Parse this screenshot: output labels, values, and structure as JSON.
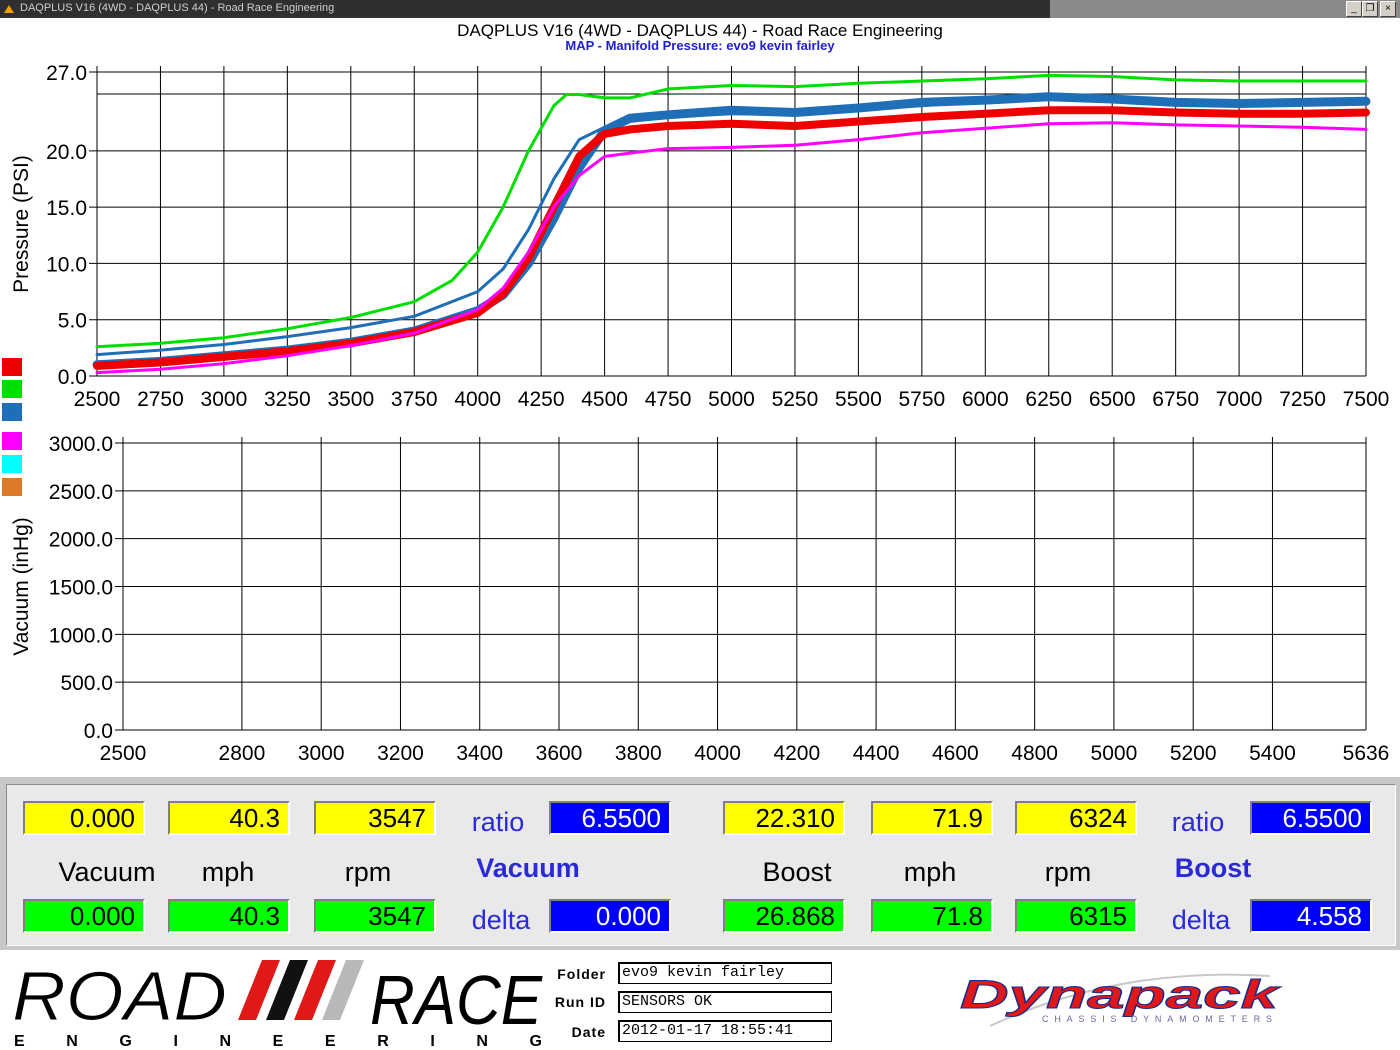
{
  "window": {
    "caption": "DAQPLUS V16 (4WD - DAQPLUS 44) - Road Race Engineering",
    "minimize_glyph": "_",
    "restore_glyph": "❐",
    "close_glyph": "×"
  },
  "chart_header": {
    "title": "DAQPLUS V16 (4WD - DAQPLUS 44) - Road Race Engineering",
    "subtitle": "MAP - Manifold Pressure: evo9 kevin fairley"
  },
  "legend_swatches": [
    "#ee0000",
    "#00dd00",
    "#1f6fb8",
    "#ff00ff",
    "#00ffff",
    "#dd7a2a"
  ],
  "chart_data": [
    {
      "type": "line",
      "ylabel": "Pressure (PSI)",
      "xlabel": "",
      "xlim": [
        2500,
        7500
      ],
      "ylim": [
        0,
        27
      ],
      "x_ticks": [
        2500,
        2750,
        3000,
        3250,
        3500,
        3750,
        4000,
        4250,
        4500,
        4750,
        5000,
        5250,
        5500,
        5750,
        6000,
        6250,
        6500,
        6750,
        7000,
        7250,
        7500
      ],
      "x_tick_labels": [
        "2500",
        "2750",
        "3000",
        "3250",
        "3500",
        "3750",
        "4000",
        "4250",
        "4500",
        "4750",
        "5000",
        "5250",
        "5500",
        "5750",
        "6000",
        "6250",
        "6500",
        "6750",
        "7000",
        "7250",
        "7500"
      ],
      "y_ticks": [
        0,
        5,
        10,
        15,
        20,
        27
      ],
      "y_tick_labels": [
        "0.0",
        "5.0",
        "10.0",
        "15.0",
        "20.0",
        "27.0"
      ],
      "grid": true,
      "series": [
        {
          "color": "#00dd00",
          "width": 3,
          "x": [
            2500,
            2750,
            3000,
            3250,
            3500,
            3750,
            3900,
            4000,
            4100,
            4200,
            4300,
            4350,
            4400,
            4500,
            4600,
            4750,
            5000,
            5250,
            5500,
            5750,
            6000,
            6250,
            6500,
            6750,
            7000,
            7250,
            7500
          ],
          "y": [
            2.6,
            2.9,
            3.4,
            4.2,
            5.2,
            6.6,
            8.5,
            11.0,
            15.0,
            20.0,
            24.0,
            25.0,
            25.0,
            24.7,
            24.7,
            25.5,
            25.8,
            25.7,
            26.0,
            26.2,
            26.4,
            26.7,
            26.6,
            26.3,
            26.2,
            26.2,
            26.2
          ]
        },
        {
          "color": "#1f6fb8",
          "width": 3,
          "x": [
            2500,
            2750,
            3000,
            3250,
            3500,
            3750,
            4000,
            4100,
            4200,
            4300,
            4400,
            4500,
            4600,
            4750,
            5000,
            5250,
            5500,
            5750,
            6000,
            6250,
            6500,
            6750,
            7000,
            7250,
            7500
          ],
          "y": [
            1.9,
            2.3,
            2.8,
            3.5,
            4.3,
            5.3,
            7.5,
            9.5,
            13.0,
            17.5,
            21.0,
            22.1,
            22.6,
            23.0,
            23.3,
            23.2,
            23.7,
            24.0,
            24.4,
            24.8,
            24.7,
            24.4,
            24.3,
            24.4,
            24.4
          ]
        },
        {
          "color": "#1f6fb8",
          "width": 9,
          "x": [
            2500,
            2750,
            3000,
            3250,
            3500,
            3750,
            4000,
            4100,
            4200,
            4300,
            4400,
            4500,
            4600,
            4750,
            5000,
            5250,
            5500,
            5750,
            6000,
            6250,
            6500,
            6750,
            7000,
            7250,
            7500
          ],
          "y": [
            1.0,
            1.3,
            1.8,
            2.3,
            3.0,
            4.0,
            5.8,
            7.2,
            10.0,
            14.0,
            18.5,
            21.8,
            22.9,
            23.2,
            23.6,
            23.4,
            23.8,
            24.3,
            24.5,
            24.8,
            24.6,
            24.3,
            24.2,
            24.3,
            24.4
          ]
        },
        {
          "color": "#ee0000",
          "width": 8,
          "x": [
            2500,
            2750,
            3000,
            3250,
            3500,
            3750,
            4000,
            4100,
            4200,
            4300,
            4400,
            4500,
            4600,
            4750,
            5000,
            5250,
            5500,
            5750,
            6000,
            6250,
            6500,
            6750,
            7000,
            7250,
            7500
          ],
          "y": [
            0.9,
            1.2,
            1.7,
            2.2,
            2.9,
            3.9,
            5.6,
            7.3,
            10.5,
            15.0,
            19.5,
            21.5,
            21.9,
            22.2,
            22.4,
            22.2,
            22.6,
            23.0,
            23.3,
            23.6,
            23.6,
            23.4,
            23.3,
            23.3,
            23.4
          ]
        },
        {
          "color": "#ff00ff",
          "width": 3,
          "x": [
            2500,
            2750,
            3000,
            3250,
            3500,
            3750,
            4000,
            4100,
            4200,
            4300,
            4400,
            4500,
            4600,
            4750,
            5000,
            5250,
            5500,
            5750,
            6000,
            6250,
            6500,
            6750,
            7000,
            7250,
            7500
          ],
          "y": [
            0.3,
            0.6,
            1.1,
            1.8,
            2.7,
            3.8,
            5.9,
            7.8,
            11.0,
            15.0,
            17.8,
            19.5,
            19.8,
            20.2,
            20.3,
            20.5,
            21.0,
            21.6,
            22.0,
            22.4,
            22.5,
            22.3,
            22.2,
            22.1,
            21.9
          ]
        }
      ]
    },
    {
      "type": "line",
      "ylabel": "Vacuum (inHg)",
      "xlabel": "",
      "xlim": [
        2500,
        5636
      ],
      "ylim": [
        0,
        3000
      ],
      "x_ticks": [
        2500,
        2800,
        3000,
        3200,
        3400,
        3600,
        3800,
        4000,
        4200,
        4400,
        4600,
        4800,
        5000,
        5200,
        5400,
        5636
      ],
      "x_tick_labels": [
        "2500",
        "2800",
        "3000",
        "3200",
        "3400",
        "3600",
        "3800",
        "4000",
        "4200",
        "4400",
        "4600",
        "4800",
        "5000",
        "5200",
        "5400",
        "5636"
      ],
      "y_ticks": [
        0,
        500,
        1000,
        1500,
        2000,
        2500,
        3000
      ],
      "y_tick_labels": [
        "0.0",
        "500.0",
        "1000.0",
        "1500.0",
        "2000.0",
        "2500.0",
        "3000.0"
      ],
      "grid": true,
      "series": []
    }
  ],
  "readouts": {
    "vacuum_top": [
      "0.000",
      "40.3",
      "3547"
    ],
    "vacuum_ratio_label": "ratio",
    "vacuum_ratio": "6.5500",
    "boost_top": [
      "22.310",
      "71.9",
      "6324"
    ],
    "boost_ratio_label": "ratio",
    "boost_ratio": "6.5500",
    "labels_left": [
      "Vacuum",
      "mph",
      "rpm"
    ],
    "section_left": "Vacuum",
    "labels_right": [
      "Boost",
      "mph",
      "rpm"
    ],
    "section_right": "Boost",
    "vacuum_bottom": [
      "0.000",
      "40.3",
      "3547"
    ],
    "vacuum_delta_label": "delta",
    "vacuum_delta": "0.000",
    "boost_bottom": [
      "26.868",
      "71.8",
      "6315"
    ],
    "boost_delta_label": "delta",
    "boost_delta": "4.558"
  },
  "footer": {
    "logo_road": "ROAD",
    "logo_race": "RACE",
    "logo_engineering": "E N G I N E E R I N G",
    "folder_label": "Folder",
    "folder_value": "evo9 kevin fairley",
    "runid_label": "Run ID",
    "runid_value": "SENSORS OK",
    "date_label": "Date",
    "date_value": "2012-01-17  18:55:41",
    "dynapack_logo": "Dynapack",
    "dynapack_tagline": "CHASSIS DYNAMOMETERS"
  },
  "colors": {
    "readout_yellow": "#ffff00",
    "readout_green": "#00ff00",
    "readout_blue": "#0000ff",
    "label_blue": "#2a2ad8",
    "logo_red": "#e01818"
  }
}
